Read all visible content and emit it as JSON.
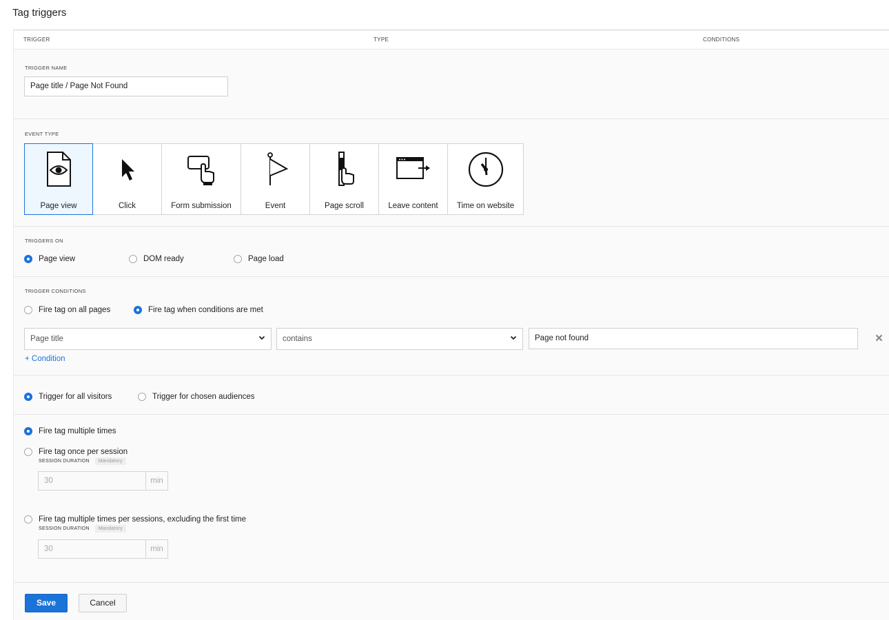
{
  "page": {
    "title": "Tag triggers"
  },
  "table_header": {
    "trigger": "TRIGGER",
    "type": "TYPE",
    "conditions": "CONDITIONS"
  },
  "trigger_name": {
    "label": "TRIGGER NAME",
    "value": "Page title / Page Not Found"
  },
  "event_type": {
    "label": "EVENT TYPE",
    "selected": "Page view",
    "options": [
      {
        "label": "Page view",
        "icon": "page-view-icon"
      },
      {
        "label": "Click",
        "icon": "cursor-icon"
      },
      {
        "label": "Form submission",
        "icon": "form-submission-icon"
      },
      {
        "label": "Event",
        "icon": "flag-icon"
      },
      {
        "label": "Page scroll",
        "icon": "page-scroll-icon"
      },
      {
        "label": "Leave content",
        "icon": "leave-content-icon"
      },
      {
        "label": "Time on website",
        "icon": "clock-icon"
      }
    ]
  },
  "triggers_on": {
    "label": "TRIGGERS ON",
    "selected": "Page view",
    "options": [
      "Page view",
      "DOM ready",
      "Page load"
    ]
  },
  "trigger_conditions": {
    "label": "TRIGGER CONDITIONS",
    "selected": "Fire tag when conditions are met",
    "options": [
      "Fire tag on all pages",
      "Fire tag when conditions are met"
    ],
    "condition": {
      "field": "Page title",
      "operator": "contains",
      "value": "Page not found"
    },
    "add_condition": "+ Condition"
  },
  "audience": {
    "selected": "Trigger for all visitors",
    "options": [
      "Trigger for all visitors",
      "Trigger for chosen audiences"
    ]
  },
  "frequency": {
    "selected": "Fire tag multiple times",
    "options": [
      {
        "label": "Fire tag multiple times"
      },
      {
        "label": "Fire tag once per session",
        "session_label": "SESSION DURATION",
        "mandatory": "Mandatory",
        "value": "30",
        "unit": "min"
      },
      {
        "label": "Fire tag multiple times per sessions, excluding the first time",
        "session_label": "SESSION DURATION",
        "mandatory": "Mandatory",
        "value": "30",
        "unit": "min"
      }
    ]
  },
  "buttons": {
    "save": "Save",
    "cancel": "Cancel"
  },
  "colors": {
    "accent": "#1a73d9",
    "selected_bg": "#eef7fe"
  }
}
